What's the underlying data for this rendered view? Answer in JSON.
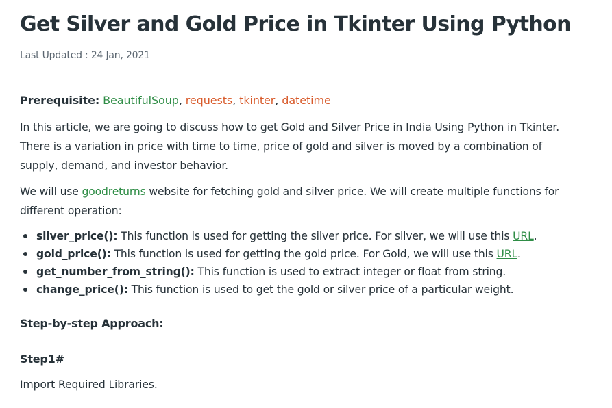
{
  "article": {
    "title": "Get Silver and Gold Price in Tkinter Using Python",
    "last_updated": "Last Updated : 24 Jan, 2021",
    "prerequisite": {
      "label": "Prerequisite:",
      "links": [
        "BeautifulSoup",
        " requests",
        "tkinter",
        "datetime"
      ],
      "separator": ","
    },
    "intro_paragraph": "In this article, we are going to discuss how to get Gold and Silver Price in India Using Python in Tkinter. There is a variation in price with time to time, price of gold and silver is moved by a combination of supply, demand, and investor behavior.",
    "usage_paragraph": {
      "before": "We will use ",
      "link": "goodreturns ",
      "after": "website for fetching gold and silver price. We will create multiple functions for different operation:"
    },
    "functions": [
      {
        "name": "silver_price():",
        "text": " This function is used for getting the silver price. For silver, we will use this ",
        "link": "URL",
        "end": "."
      },
      {
        "name": "gold_price():",
        "text": " This function is used for getting the gold price. For Gold, we will use this ",
        "link": "URL",
        "end": "."
      },
      {
        "name": "get_number_from_string():",
        "text": " This function is used to extract integer or float from string."
      },
      {
        "name": "change_price():",
        "text": " This function is used to get the gold or silver price of a particular weight."
      }
    ],
    "approach_heading": "Step-by-step Approach:",
    "step1_heading": "Step1#",
    "step1_text": "Import Required Libraries."
  },
  "colors": {
    "text": "#273239",
    "link_green": "#2f8d46",
    "link_orange": "#d85a2a"
  }
}
